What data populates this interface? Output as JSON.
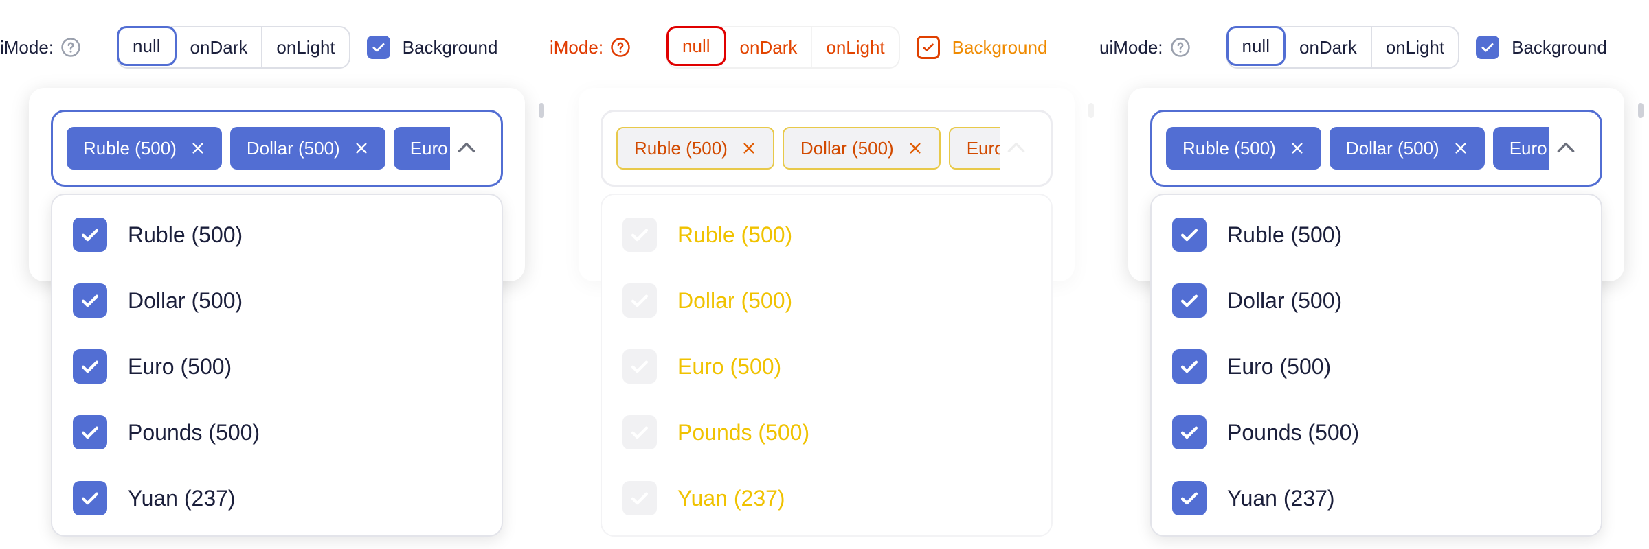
{
  "toolbar": {
    "mode_label_left": "iMode:",
    "mode_label_middle": "iMode:",
    "mode_label_right": "uiMode:",
    "segments": [
      "null",
      "onDark",
      "onLight"
    ],
    "selected_segment": "null",
    "background_label": "Background",
    "background_checked": true
  },
  "combobox": {
    "tags": [
      "Ruble (500)",
      "Dollar (500)",
      "Euro"
    ]
  },
  "dropdown": {
    "options": [
      "Ruble (500)",
      "Dollar (500)",
      "Euro (500)",
      "Pounds (500)",
      "Yuan (237)"
    ]
  },
  "icons": {
    "help": "question-circle-icon",
    "checkbox": "check-icon",
    "tag_remove": "close-icon",
    "collapse": "chevron-up-icon"
  },
  "colors": {
    "accent": "#526ed3",
    "text": "#1b1f3b",
    "border": "#dddfe6",
    "muted_icon": "#9aa0ad"
  }
}
